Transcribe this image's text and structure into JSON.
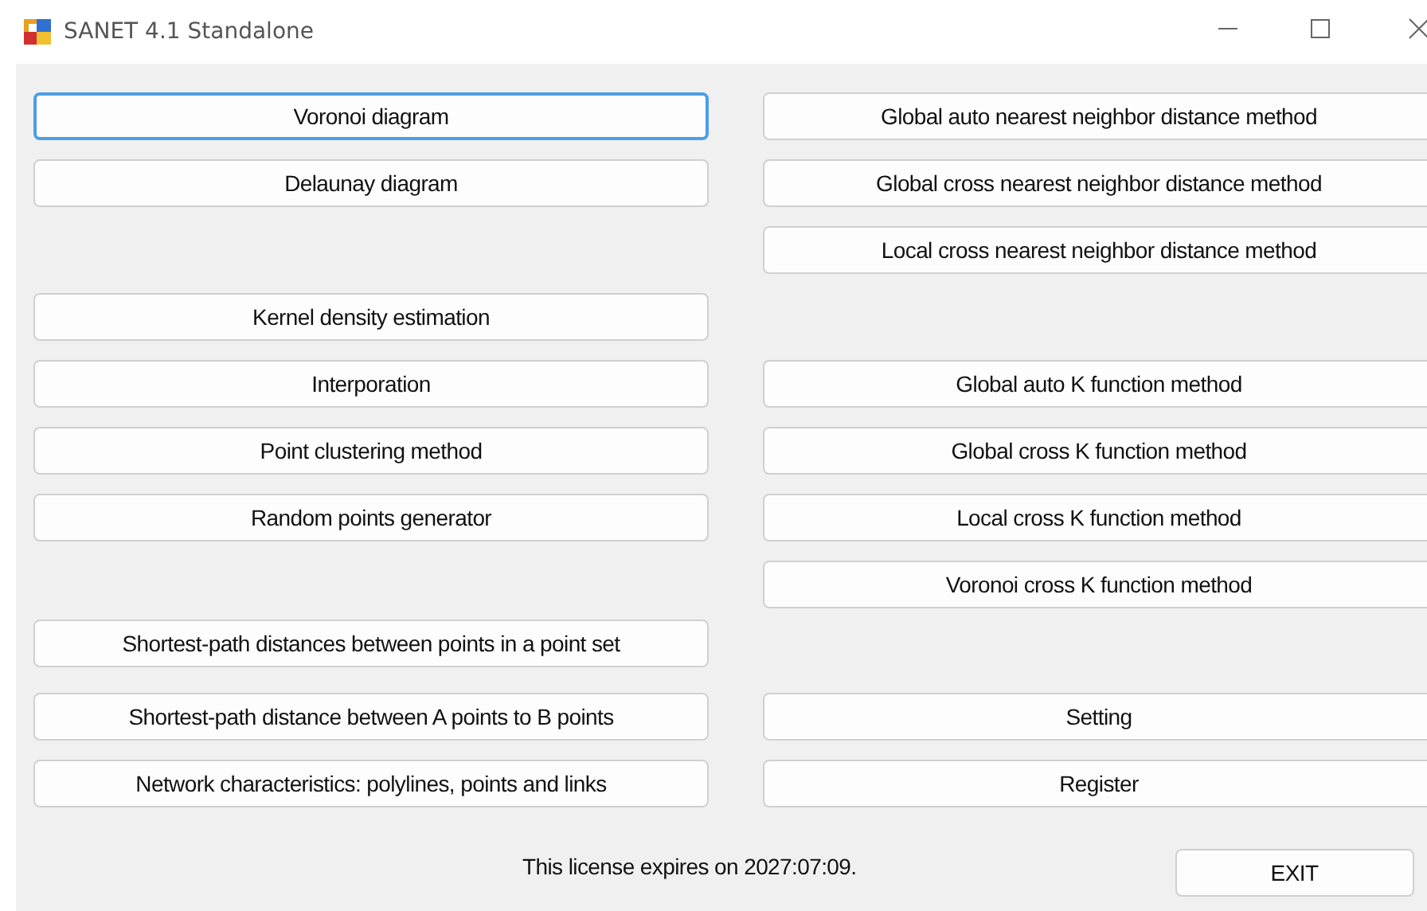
{
  "window": {
    "title": "SANET 4.1 Standalone"
  },
  "rows": [
    {
      "left": {
        "label": "Voronoi diagram",
        "focused": true
      },
      "right": {
        "label": "Global auto nearest neighbor distance method",
        "focused": false
      }
    },
    {
      "left": {
        "label": "Delaunay diagram",
        "focused": false
      },
      "right": {
        "label": "Global cross nearest neighbor distance method",
        "focused": false
      }
    },
    {
      "right": {
        "label": "Local cross nearest neighbor distance method",
        "focused": false
      }
    },
    {
      "left": {
        "label": "Kernel density estimation",
        "focused": false
      }
    },
    {
      "left": {
        "label": "Interporation",
        "focused": false
      },
      "right": {
        "label": "Global auto K function method",
        "focused": false
      }
    },
    {
      "left": {
        "label": "Point clustering method",
        "focused": false
      },
      "right": {
        "label": "Global cross K function method",
        "focused": false
      }
    },
    {
      "left": {
        "label": "Random points generator",
        "focused": false
      },
      "right": {
        "label": "Local cross K function method",
        "focused": false
      }
    },
    {
      "right": {
        "label": "Voronoi cross K function method",
        "focused": false
      }
    },
    {
      "left": {
        "label": "Shortest-path distances between points in a point set",
        "focused": false
      }
    },
    {
      "left": {
        "label": "Shortest-path distance between A points to B points",
        "focused": false
      },
      "right": {
        "label": "Setting",
        "focused": false
      }
    },
    {
      "left": {
        "label": "Network characteristics: polylines, points and links",
        "focused": false
      },
      "right": {
        "label": "Register",
        "focused": false
      }
    }
  ],
  "footer": {
    "license": "This license expires on 2027:07:09.",
    "exit": {
      "label": "EXIT",
      "focused": false
    }
  }
}
